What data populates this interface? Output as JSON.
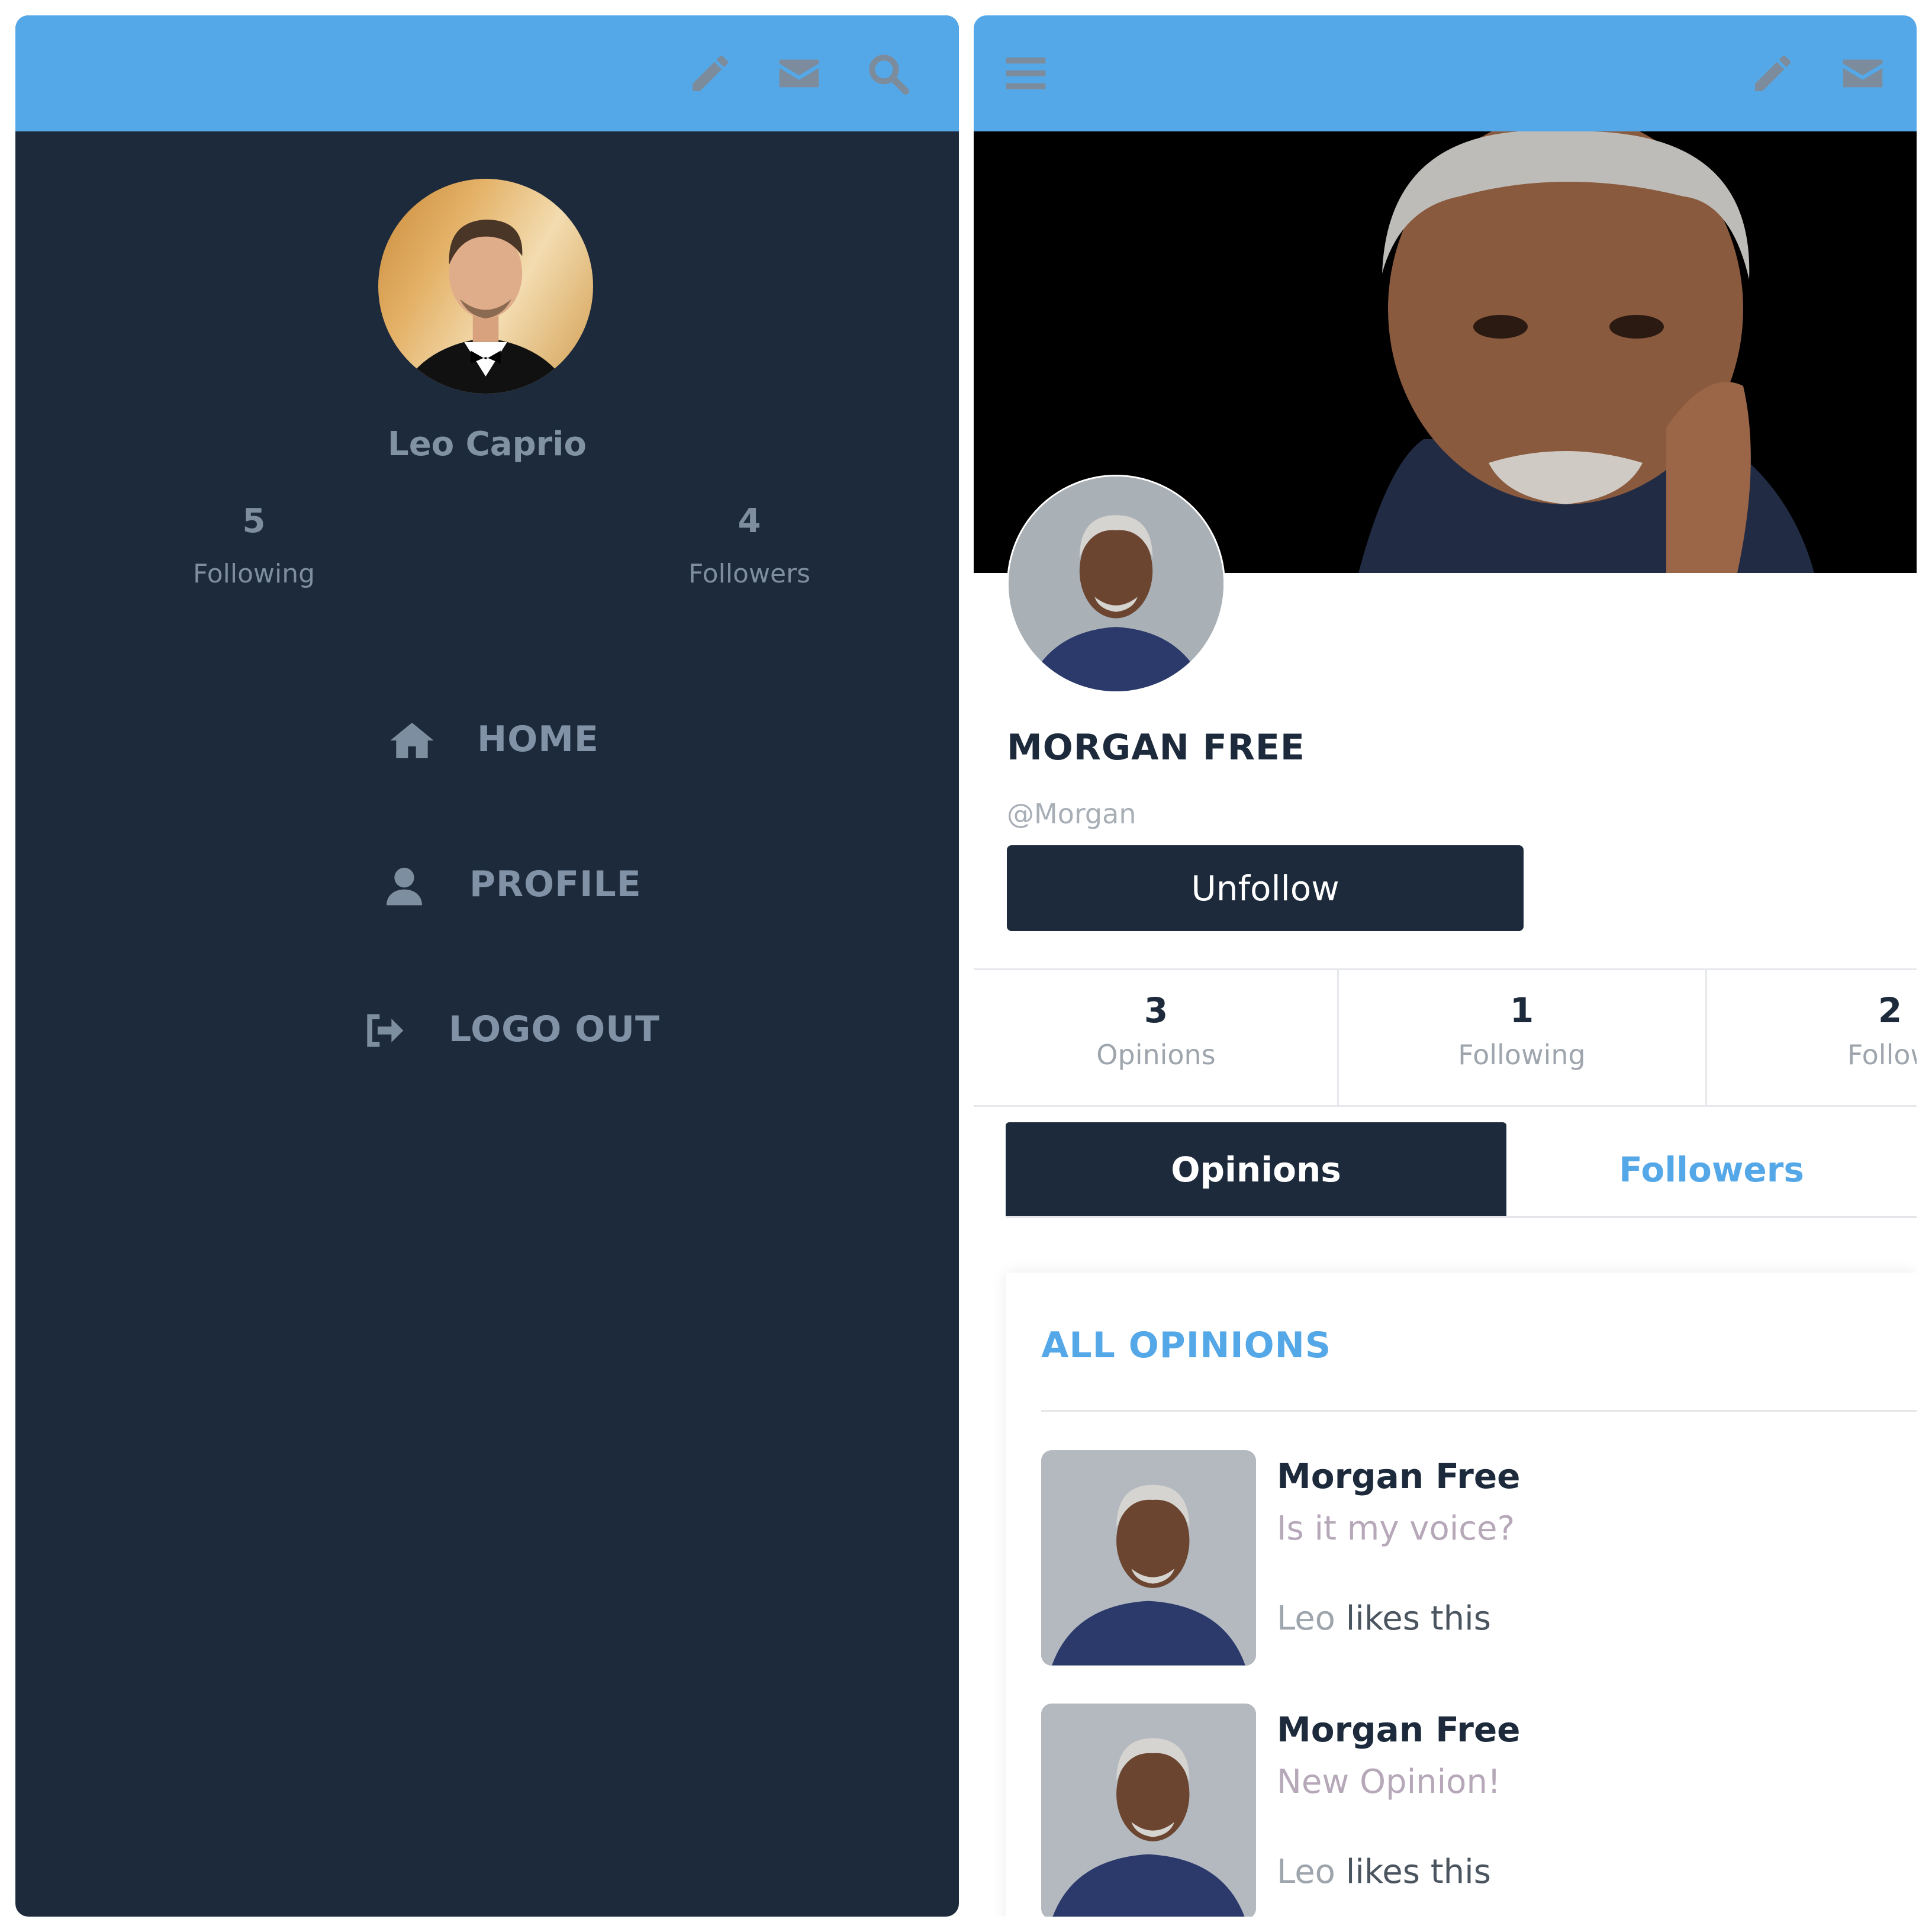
{
  "colors": {
    "topbar": "#55a8e8",
    "sidebar_bg": "#1d2a3b",
    "primary_dark": "#1d2a3b",
    "accent_blue": "#55a8e8"
  },
  "left": {
    "toolbar_icons": [
      "pencil-icon",
      "envelope-icon",
      "search-icon"
    ],
    "user_name": "Leo Caprio",
    "stats": [
      {
        "value": "5",
        "label": "Following"
      },
      {
        "value": "4",
        "label": "Followers"
      }
    ],
    "menu": [
      {
        "icon": "home-icon",
        "label": "HOME"
      },
      {
        "icon": "user-icon",
        "label": "PROFILE"
      },
      {
        "icon": "logout-icon",
        "label": "LOGO OUT"
      }
    ]
  },
  "right": {
    "toolbar_icons": [
      "hamburger-menu-icon",
      "pencil-icon",
      "envelope-icon"
    ],
    "profile": {
      "name": "MORGAN FREE",
      "handle": "@Morgan",
      "button": "Unfollow"
    },
    "stats": [
      {
        "value": "3",
        "label": "Opinions"
      },
      {
        "value": "1",
        "label": "Following"
      },
      {
        "value": "2",
        "label": "Follow"
      }
    ],
    "tabs": [
      {
        "label": "Opinions",
        "active": true
      },
      {
        "label": "Followers",
        "active": false
      }
    ],
    "opinions_title": "ALL OPINIONS",
    "opinions": [
      {
        "author": "Morgan Free",
        "text": "Is it my voice?",
        "liker": "Leo",
        "likes_suffix": " likes this"
      },
      {
        "author": "Morgan Free",
        "text": "New Opinion!",
        "liker": "Leo",
        "likes_suffix": " likes this"
      }
    ]
  }
}
